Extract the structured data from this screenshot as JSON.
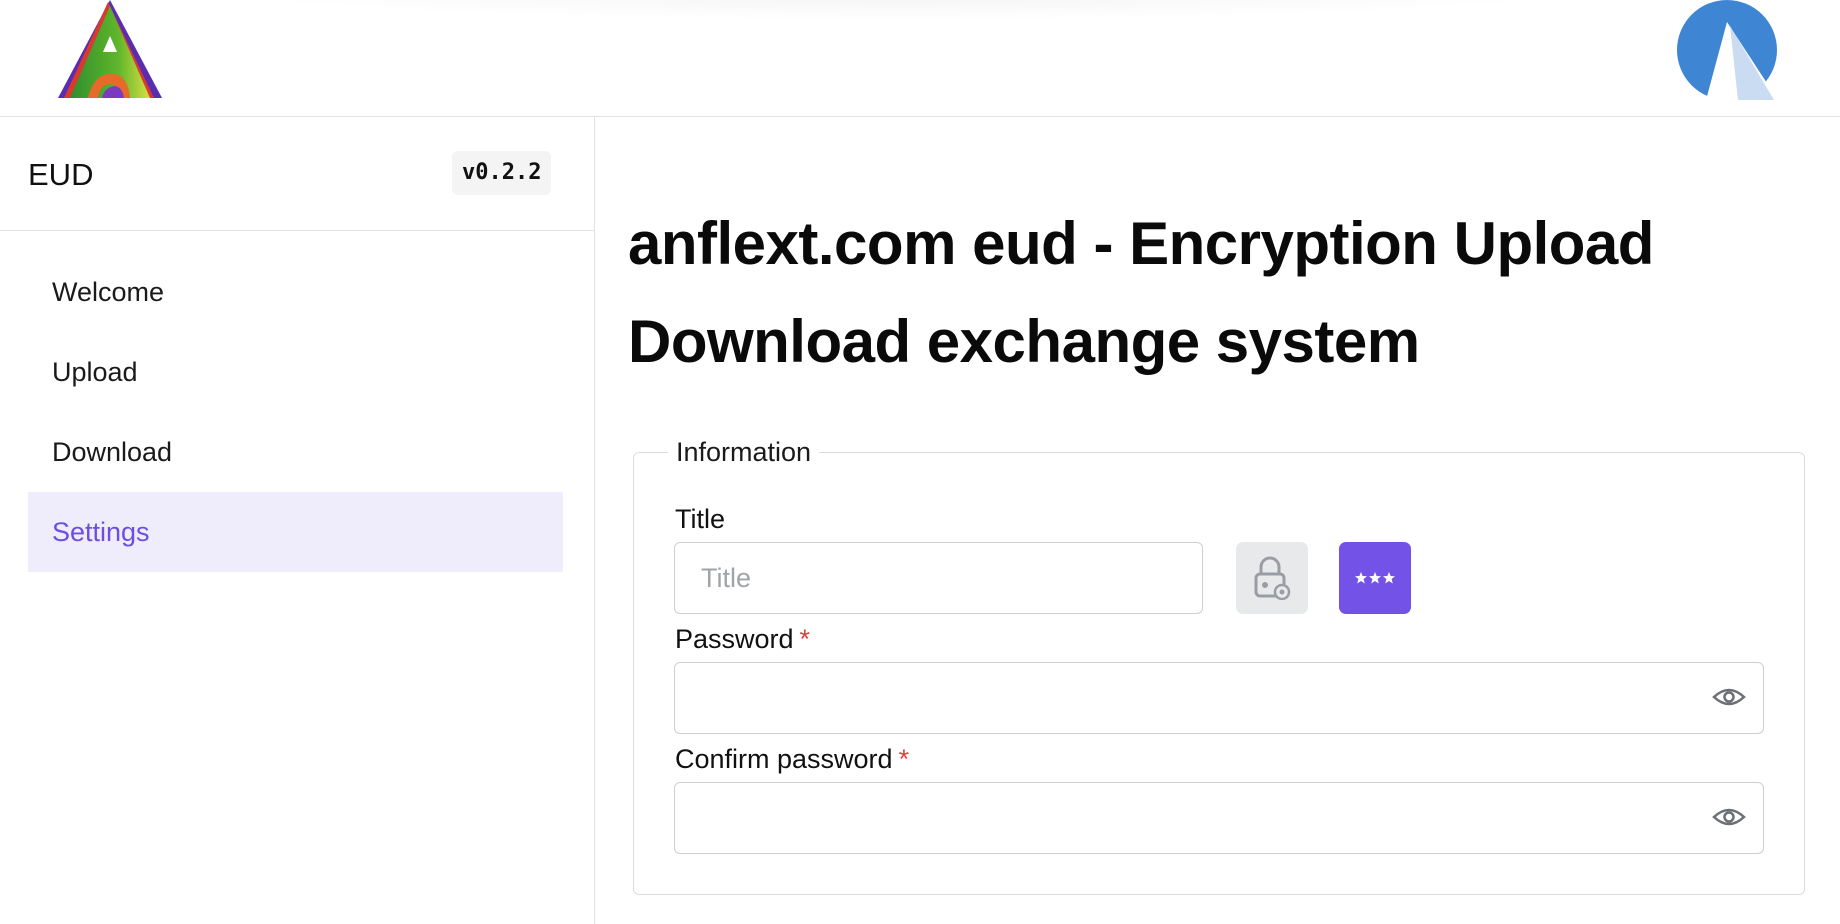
{
  "header": {
    "left_logo": "anflext-logo",
    "right_logo": "blue-circle-logo"
  },
  "sidebar": {
    "app_name": "EUD",
    "version": "v0.2.2",
    "items": [
      {
        "label": "Welcome",
        "active": false
      },
      {
        "label": "Upload",
        "active": false
      },
      {
        "label": "Download",
        "active": false
      },
      {
        "label": "Settings",
        "active": true
      }
    ]
  },
  "main": {
    "title": "anflext.com eud - Encryption Upload Download exchange system",
    "form": {
      "legend": "Information",
      "title_label": "Title",
      "title_placeholder": "Title",
      "title_value": "",
      "lock_button_icon": "lock-gear-icon",
      "generate_button_icon": "password-dots-icon",
      "password_label": "Password",
      "password_required": "*",
      "password_value": "",
      "confirm_label": "Confirm password",
      "confirm_required": "*",
      "confirm_value": "",
      "eye_icon": "eye-icon"
    }
  },
  "colors": {
    "accent": "#7352e8",
    "active_bg": "#efecfb",
    "active_text": "#6b4fe0",
    "required": "#e0403a"
  }
}
